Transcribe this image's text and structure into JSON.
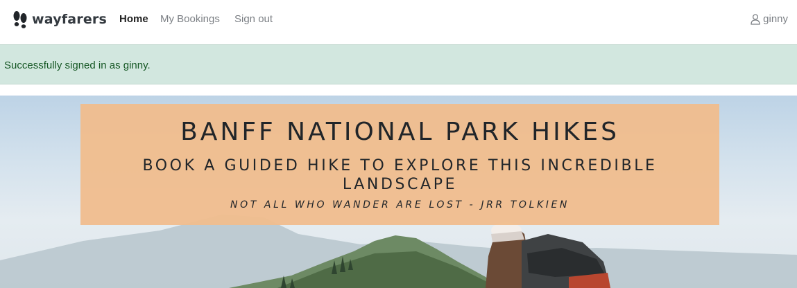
{
  "nav": {
    "brand": "wayfarers",
    "brand_icon": "footprints-icon",
    "links": [
      "Home",
      "My Bookings",
      "Sign out"
    ],
    "active_link": "Home",
    "user": "ginny",
    "user_icon": "person-icon"
  },
  "alert": {
    "message": "Successfully signed in as ginny.",
    "color": "#d2e7df"
  },
  "hero": {
    "title": "BANFF NATIONAL PARK HIKES",
    "subtitle": "BOOK A GUIDED HIKE TO EXPLORE THIS INCREDIBLE LANDSCAPE",
    "quote": "NOT ALL WHO WANDER ARE LOST - JRR TOLKIEN",
    "banner_color": "#f0bd8d"
  }
}
